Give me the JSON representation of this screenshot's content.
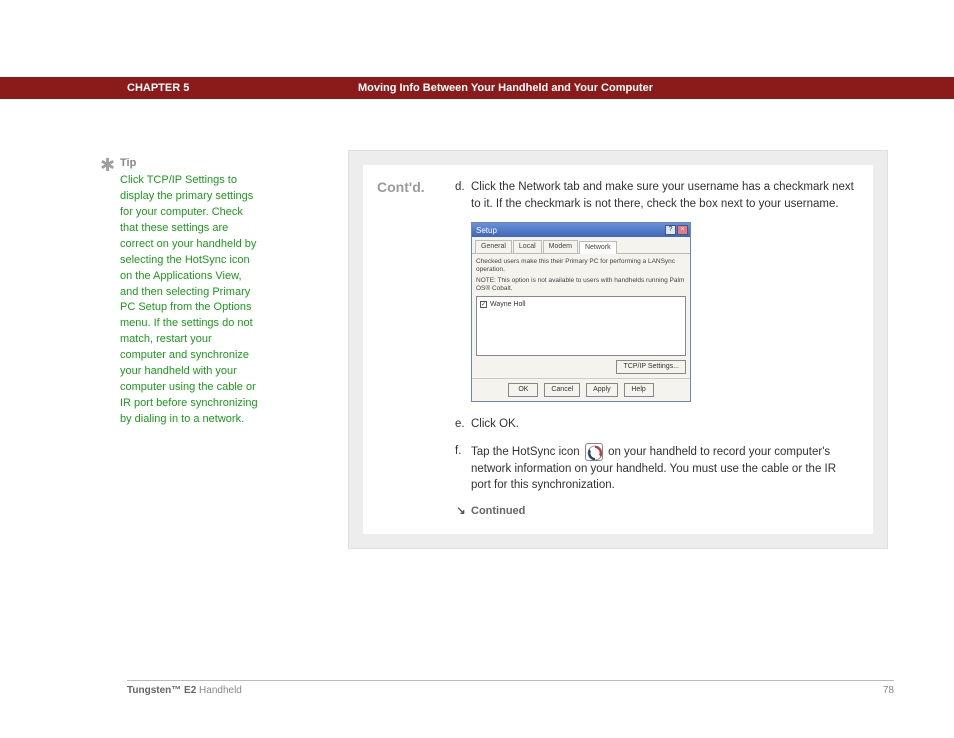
{
  "header": {
    "chapter": "CHAPTER 5",
    "title": "Moving Info Between Your Handheld and Your Computer"
  },
  "tip": {
    "label": "Tip",
    "text": "Click TCP/IP Settings to display the primary settings for your computer. Check that these settings are correct on your handheld by selecting the HotSync icon on the Applications View, and then selecting Primary PC Setup from the Options menu. If the settings do not match, restart your computer and synchronize your handheld with your computer using the cable or IR port before synchronizing by dialing in to a network."
  },
  "contd": "Cont'd.",
  "steps": {
    "d_label": "d.",
    "d_text": "Click the Network tab and make sure your username has a checkmark next to it. If the checkmark is not there, check the box next to your username.",
    "e_label": "e.",
    "e_text": "Click OK.",
    "f_label": "f.",
    "f_text_a": "Tap the HotSync icon ",
    "f_text_b": " on your handheld to record your computer's network information on your handheld. You must use the cable or the IR port for this synchronization."
  },
  "dialog": {
    "title": "Setup",
    "tabs": {
      "general": "General",
      "local": "Local",
      "modem": "Modem",
      "network": "Network"
    },
    "note1": "Checked users make this their Primary PC for performing a LANSync operation.",
    "note2": "NOTE: This option is not available to users with handhelds running Palm OS® Cobalt.",
    "check": "✓",
    "user": "Wayne Holl",
    "tcpip": "TCP/IP Settings...",
    "ok": "OK",
    "cancel": "Cancel",
    "apply": "Apply",
    "help": "Help",
    "help_q": "?",
    "close_x": "×"
  },
  "continued": "Continued",
  "footer": {
    "product_bold": "Tungsten™ E2",
    "product_rest": " Handheld",
    "page": "78"
  }
}
